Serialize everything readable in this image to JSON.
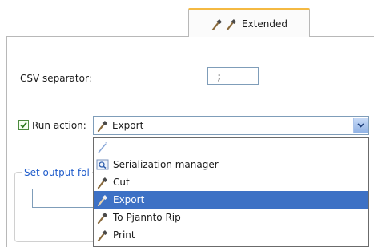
{
  "tab": {
    "label": "Extended",
    "icons": [
      "hammer-icon",
      "hammer-icon"
    ]
  },
  "csv": {
    "label": "CSV separator:",
    "value": ";"
  },
  "run_action": {
    "label": "Run action:",
    "checked": true,
    "selected": "Export"
  },
  "output_group": {
    "title": "Set output fol"
  },
  "dropdown": {
    "items": [
      {
        "label": "",
        "icon": "wand-icon",
        "selected": false
      },
      {
        "label": "Serialization manager",
        "icon": "search-window-icon",
        "selected": false
      },
      {
        "label": "Cut",
        "icon": "hammer-icon",
        "selected": false
      },
      {
        "label": "Export",
        "icon": "hammer-icon",
        "selected": true
      },
      {
        "label": "To Pjannto Rip",
        "icon": "hammer-icon",
        "selected": false
      },
      {
        "label": "Print",
        "icon": "hammer-icon",
        "selected": false
      }
    ]
  },
  "colors": {
    "accent": "#3d71c5",
    "tab_highlight": "#f4b942",
    "group_title": "#1f5ccb"
  }
}
